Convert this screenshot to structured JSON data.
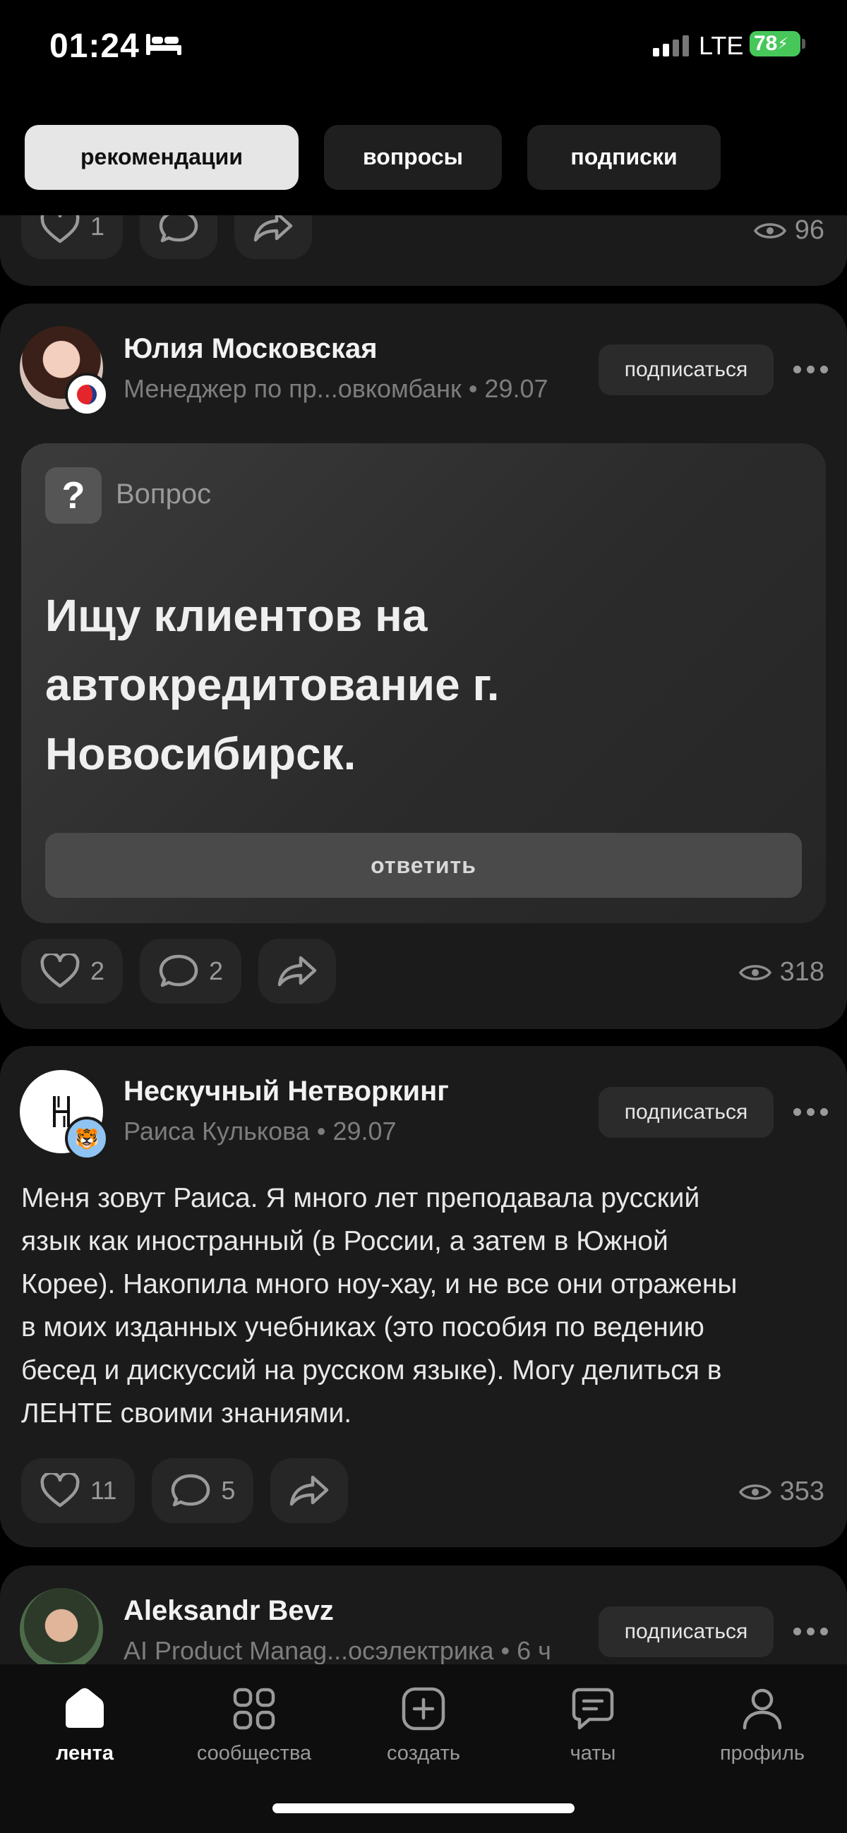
{
  "status_bar": {
    "time": "01:24",
    "network": "LTE",
    "battery": "78"
  },
  "tabs": [
    {
      "label": "рекомендации",
      "active": true
    },
    {
      "label": "вопросы",
      "active": false
    },
    {
      "label": "подписки",
      "active": false
    }
  ],
  "posts": [
    {
      "likes": "1",
      "comments": "",
      "views": "96"
    },
    {
      "author": "Юлия Московская",
      "meta": "Менеджер по пр...овкомбанк • 29.07",
      "subscribe_label": "подписаться",
      "question_label": "Вопрос",
      "question_text": "Ищу клиентов на автокредитование г. Новосибирск.",
      "answer_label": "ответить",
      "likes": "2",
      "comments": "2",
      "views": "318"
    },
    {
      "author": "Нескучный Нетворкинг",
      "meta": "Раиса Кулькова • 29.07",
      "subscribe_label": "подписаться",
      "text": "Меня зовут Раиса. Я много лет преподавала русский\nязык как иностранный (в России, а затем в Южной\nКорее). Накопила много ноу-хау, и не все они отражены\nв моих изданных  учебниках (это пособия по ведению\nбесед и дискуссий на русском языке). Могу делиться в\nЛЕНТЕ своими знаниями.",
      "likes": "11",
      "comments": "5",
      "views": "353"
    },
    {
      "author": "Aleksandr Bevz",
      "meta": "AI Product Manag...осэлектрика • 6 ч",
      "subscribe_label": "подписаться"
    }
  ],
  "bottom_nav": [
    {
      "label": "лента",
      "icon": "home-icon",
      "active": true
    },
    {
      "label": "сообщества",
      "icon": "grid-icon",
      "active": false
    },
    {
      "label": "создать",
      "icon": "plus-square-icon",
      "active": false
    },
    {
      "label": "чаты",
      "icon": "chat-icon",
      "active": false
    },
    {
      "label": "профиль",
      "icon": "person-icon",
      "active": false
    }
  ],
  "colors": {
    "background": "#000000",
    "card": "#1b1b1b",
    "battery": "#47c75a"
  }
}
